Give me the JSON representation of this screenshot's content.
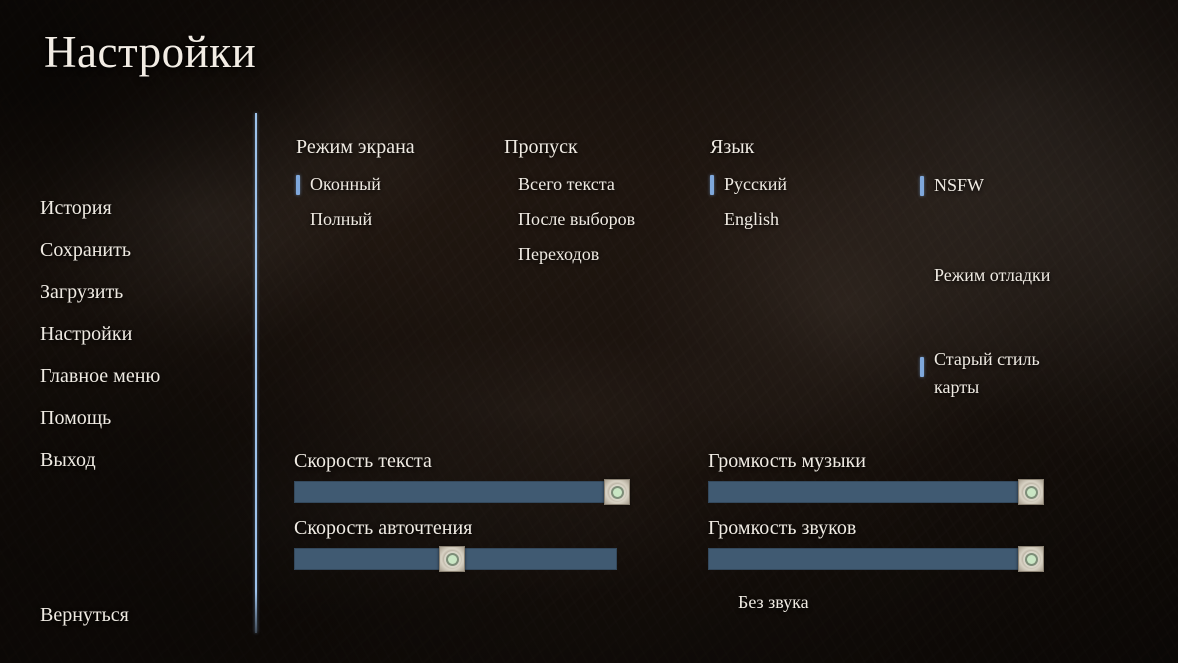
{
  "window": {
    "title": "Настройки"
  },
  "sidebar": {
    "items": [
      {
        "label": "История"
      },
      {
        "label": "Сохранить"
      },
      {
        "label": "Загрузить"
      },
      {
        "label": "Настройки"
      },
      {
        "label": "Главное меню"
      },
      {
        "label": "Помощь"
      },
      {
        "label": "Выход"
      }
    ],
    "return_label": "Вернуться"
  },
  "options": {
    "display": {
      "header": "Режим экрана",
      "items": [
        {
          "label": "Оконный",
          "selected": true
        },
        {
          "label": "Полный",
          "selected": false
        }
      ]
    },
    "skip": {
      "header": "Пропуск",
      "items": [
        {
          "label": "Всего текста",
          "selected": false
        },
        {
          "label": "После выборов",
          "selected": false
        },
        {
          "label": "Переходов",
          "selected": false
        }
      ]
    },
    "language": {
      "header": "Язык",
      "items": [
        {
          "label": "Русский",
          "selected": true
        },
        {
          "label": "English",
          "selected": false
        }
      ]
    },
    "extras": {
      "items": [
        {
          "label": "NSFW",
          "selected": true
        },
        {
          "label": "Режим отладки",
          "selected": false
        },
        {
          "label": "Старый стиль карты",
          "selected": true
        }
      ]
    }
  },
  "sliders": {
    "text_speed": {
      "label": "Скорость текста",
      "value": 100
    },
    "auto_forward_time": {
      "label": "Скорость авточтения",
      "value": 49
    },
    "music_volume": {
      "label": "Громкость музыки",
      "value": 100
    },
    "sound_volume": {
      "label": "Громкость звуков",
      "value": 100
    }
  },
  "mute": {
    "label": "Без звука",
    "selected": false
  },
  "colors": {
    "accent": "#7fa8dc",
    "divider": "#9ec3ec",
    "slider_track": "#405a72",
    "text": "#efeae2"
  }
}
